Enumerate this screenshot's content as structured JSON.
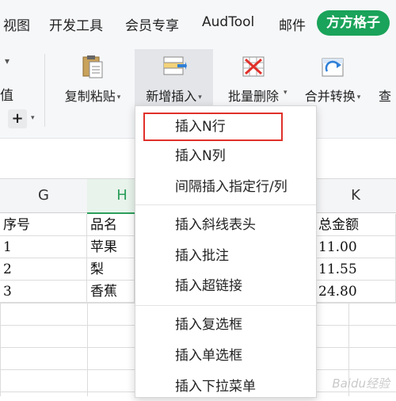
{
  "menubar": {
    "tabs": [
      {
        "label": "视图"
      },
      {
        "label": "开发工具"
      },
      {
        "label": "会员专享"
      },
      {
        "label": "AudTool"
      },
      {
        "label": "邮件"
      }
    ],
    "brand_tab": "方方格子"
  },
  "ribbon": {
    "left_partial_label": "值",
    "left_partial_dropdown": "▾",
    "left_plus": "+",
    "buttons": [
      {
        "label": "复制粘贴",
        "icon": "clipboard-paste-icon"
      },
      {
        "label": "新增插入",
        "icon": "insert-rows-icon"
      },
      {
        "label": "批量删除",
        "icon": "delete-table-icon"
      },
      {
        "label": "合并转换",
        "icon": "merge-convert-icon"
      },
      {
        "label": "查"
      }
    ],
    "caret": "▾"
  },
  "sheet": {
    "columns": [
      "G",
      "H",
      "K"
    ],
    "header_row": [
      "序号",
      "品名",
      "总金额"
    ],
    "rows": [
      {
        "seq": "1",
        "name": "苹果",
        "total": "11.00"
      },
      {
        "seq": "2",
        "name": "梨",
        "total": "11.55"
      },
      {
        "seq": "3",
        "name": "香蕉",
        "total": "24.80"
      }
    ]
  },
  "dropdown": {
    "items": [
      {
        "label": "插入N行",
        "highlighted": true
      },
      {
        "label": "插入N列"
      },
      {
        "label": "间隔插入指定行/列"
      },
      {
        "label": "插入斜线表头"
      },
      {
        "label": "插入批注"
      },
      {
        "label": "插入超链接"
      },
      {
        "label": "插入复选框"
      },
      {
        "label": "插入单选框"
      },
      {
        "label": "插入下拉菜单"
      }
    ]
  },
  "watermark": "Baidu经验",
  "colors": {
    "brand": "#1aa35a",
    "highlight_border": "#e0302a",
    "selected_column": "#2c9e5b"
  }
}
